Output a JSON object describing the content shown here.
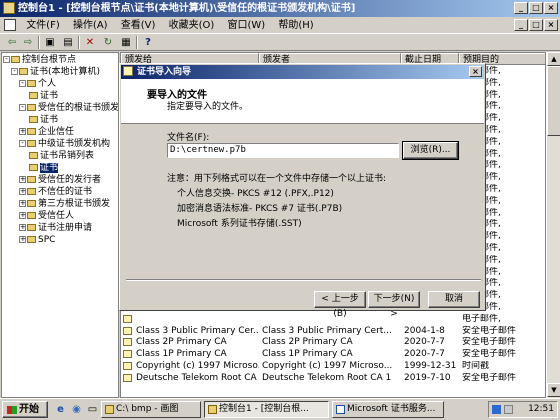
{
  "window": {
    "title": "控制台1 - [控制台根节点\\证书(本地计算机)\\受信任的根证书颁发机构\\证书]",
    "window_buttons": [
      "_",
      "□",
      "×"
    ],
    "inner_buttons": [
      "_",
      "□",
      "×"
    ]
  },
  "menu": [
    "文件(F)",
    "操作(A)",
    "查看(V)",
    "收藏夹(O)",
    "窗口(W)",
    "帮助(H)"
  ],
  "toolbar": {
    "back": "⇦",
    "forward": "⇨",
    "up": "▣",
    "show_hide": "▤",
    "delete": "✕",
    "refresh": "↻",
    "export": "▦",
    "help": "?"
  },
  "tree": [
    {
      "label": "控制台根节点",
      "expander": "-",
      "selected": false
    },
    {
      "label": "证书(本地计算机)",
      "expander": "-",
      "selected": false
    },
    {
      "label": "个人",
      "expander": "-",
      "selected": false
    },
    {
      "label": "证书",
      "expander": "",
      "selected": false
    },
    {
      "label": "受信任的根证书颁发机构",
      "expander": "-",
      "selected": false
    },
    {
      "label": "证书",
      "expander": "",
      "selected": false
    },
    {
      "label": "企业信任",
      "expander": "+",
      "selected": false
    },
    {
      "label": "中级证书颁发机构",
      "expander": "-",
      "selected": false
    },
    {
      "label": "证书吊销列表",
      "expander": "",
      "selected": false
    },
    {
      "label": "证书",
      "expander": "",
      "selected": true
    },
    {
      "label": "受信任的发行者",
      "expander": "+",
      "selected": false
    },
    {
      "label": "不信任的证书",
      "expander": "+",
      "selected": false
    },
    {
      "label": "第三方根证书颁发",
      "expander": "+",
      "selected": false
    },
    {
      "label": "受信任人",
      "expander": "+",
      "selected": false
    },
    {
      "label": "证书注册申请",
      "expander": "+",
      "selected": false
    },
    {
      "label": "SPC",
      "expander": "+",
      "selected": false
    }
  ],
  "list": {
    "columns": [
      "颁发给",
      "颁发者",
      "截止日期",
      "预期目的"
    ],
    "rows": [
      {
        "issued_to": "",
        "issued_by": "",
        "expires": "",
        "purpose": "电子邮件,"
      },
      {
        "issued_to": "",
        "issued_by": "",
        "expires": "",
        "purpose": "电子邮件,"
      },
      {
        "issued_to": "",
        "issued_by": "",
        "expires": "",
        "purpose": "电子邮件,"
      },
      {
        "issued_to": "",
        "issued_by": "",
        "expires": "",
        "purpose": "电子邮件,"
      },
      {
        "issued_to": "",
        "issued_by": "",
        "expires": "",
        "purpose": "电子邮件,"
      },
      {
        "issued_to": "",
        "issued_by": "",
        "expires": "",
        "purpose": "电子邮件,"
      },
      {
        "issued_to": "",
        "issued_by": "",
        "expires": "",
        "purpose": "电子邮件,"
      },
      {
        "issued_to": "",
        "issued_by": "",
        "expires": "",
        "purpose": "电子邮件,"
      },
      {
        "issued_to": "",
        "issued_by": "",
        "expires": "",
        "purpose": "电子邮件,"
      },
      {
        "issued_to": "",
        "issued_by": "",
        "expires": "",
        "purpose": "电子邮件,"
      },
      {
        "issued_to": "",
        "issued_by": "",
        "expires": "",
        "purpose": "电子邮件,"
      },
      {
        "issued_to": "",
        "issued_by": "",
        "expires": "",
        "purpose": "电子邮件,"
      },
      {
        "issued_to": "",
        "issued_by": "",
        "expires": "",
        "purpose": "电子邮件,"
      },
      {
        "issued_to": "",
        "issued_by": "",
        "expires": "",
        "purpose": "电子邮件,"
      },
      {
        "issued_to": "",
        "issued_by": "",
        "expires": "",
        "purpose": "电子邮件,"
      },
      {
        "issued_to": "",
        "issued_by": "",
        "expires": "",
        "purpose": "电子邮件,"
      },
      {
        "issued_to": "",
        "issued_by": "",
        "expires": "",
        "purpose": "电子邮件,"
      },
      {
        "issued_to": "",
        "issued_by": "",
        "expires": "",
        "purpose": "电子邮件,"
      },
      {
        "issued_to": "",
        "issued_by": "",
        "expires": "",
        "purpose": "电子邮件,"
      },
      {
        "issued_to": "",
        "issued_by": "",
        "expires": "",
        "purpose": "电子邮件,"
      },
      {
        "issued_to": "",
        "issued_by": "",
        "expires": "",
        "purpose": "电子邮件,"
      },
      {
        "issued_to": "",
        "issued_by": "",
        "expires": "",
        "purpose": "电子邮件,"
      },
      {
        "issued_to": "Class 3 Public Primary Cer...",
        "issued_by": "Class 3 Public Primary Cert...",
        "expires": "2004-1-8",
        "purpose": "安全电子邮件"
      },
      {
        "issued_to": "Class 2P Primary CA",
        "issued_by": "Class 2P Primary CA",
        "expires": "2020-7-7",
        "purpose": "安全电子邮件"
      },
      {
        "issued_to": "Class 1P Primary CA",
        "issued_by": "Class 1P Primary CA",
        "expires": "2020-7-7",
        "purpose": "安全电子邮件"
      },
      {
        "issued_to": "Copyright (c) 1997 Microso...",
        "issued_by": "Copyright (c) 1997 Microso...",
        "expires": "1999-12-31",
        "purpose": "时间戳"
      },
      {
        "issued_to": "Deutsche Telekom Root CA 1",
        "issued_by": "Deutsche Telekom Root CA 1",
        "expires": "2019-7-10",
        "purpose": "安全电子邮件"
      }
    ]
  },
  "dialog": {
    "title": "证书导入向导",
    "close": "×",
    "heading": "要导入的文件",
    "subheading": "指定要导入的文件。",
    "file_label": "文件名(F):",
    "file_value": "D:\\certnew.p7b",
    "browse": "浏览(R)...",
    "note": "注意：用下列格式可以在一个文件中存储一个以上证书:",
    "formats": [
      "个人信息交换- PKCS #12 (.PFX,.P12)",
      "加密消息语法标准- PKCS #7 证书(.P7B)",
      "Microsoft 系列证书存储(.SST)"
    ],
    "back": "< 上一步(B)",
    "next": "下一步(N) >",
    "cancel": "取消"
  },
  "taskbar": {
    "start": "开始",
    "quick_launch": [
      "e",
      "◉",
      "▭"
    ],
    "tasks": [
      "C:\\ bmp - 画图",
      "控制台1 - [控制台根...",
      "Microsoft 证书服务..."
    ],
    "active_task": 1,
    "clock": "12:51"
  }
}
